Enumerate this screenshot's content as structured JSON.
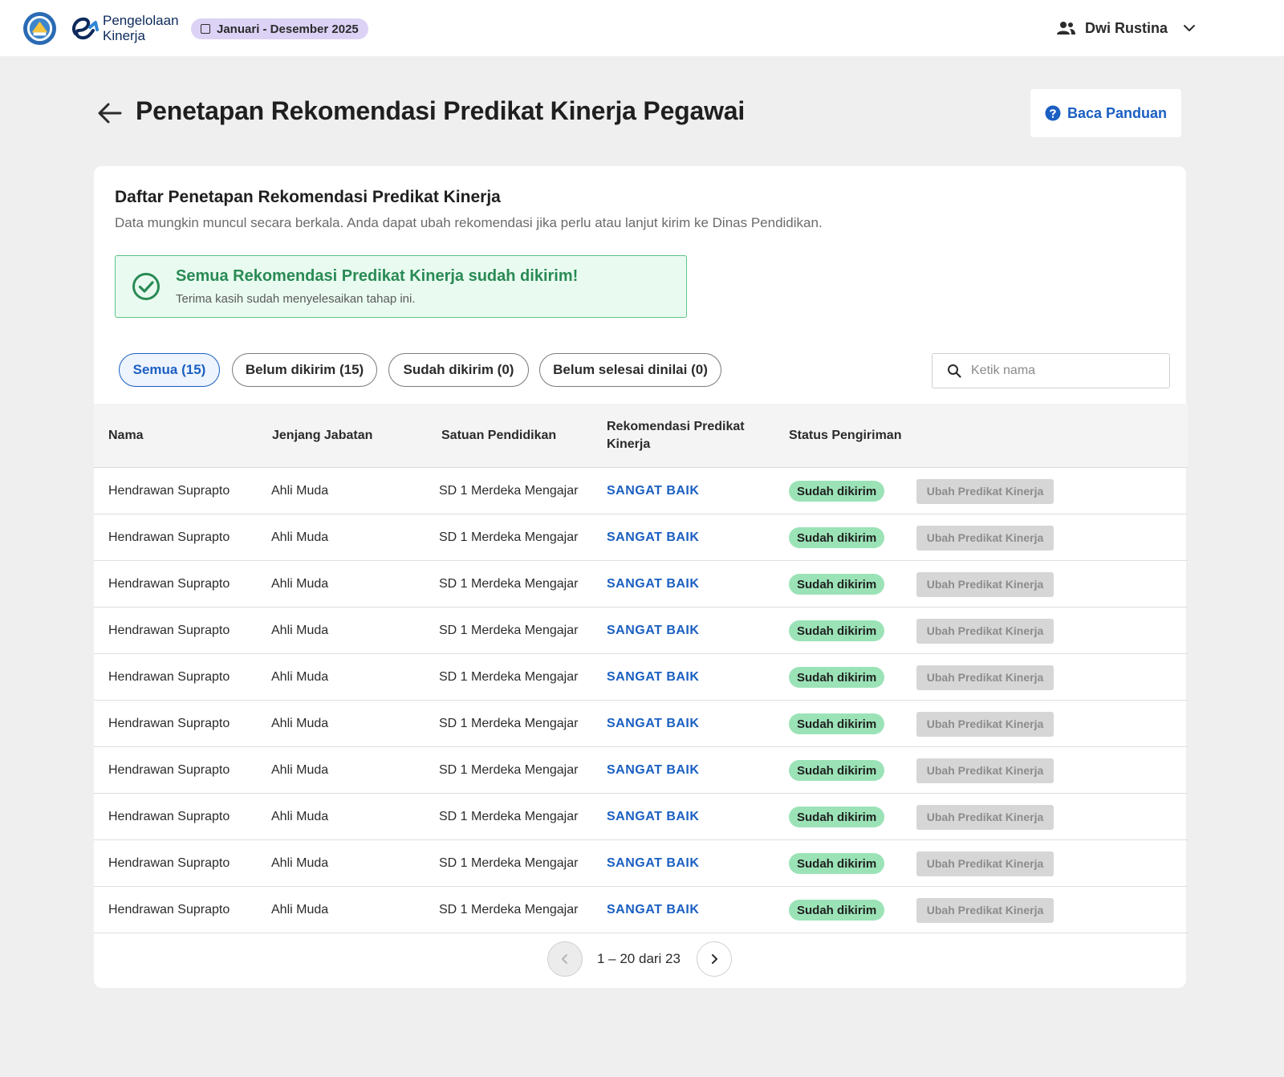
{
  "header": {
    "app_name_line1": "Pengelolaan",
    "app_name_line2": "Kinerja",
    "period": "Januari - Desember 2025",
    "user_name": "Dwi Rustina"
  },
  "page": {
    "title": "Penetapan Rekomendasi Predikat Kinerja Pegawai",
    "guide_label": "Baca Panduan"
  },
  "card": {
    "title": "Daftar Penetapan Rekomendasi Predikat Kinerja",
    "subtitle": "Data mungkin muncul secara berkala. Anda dapat ubah rekomendasi jika perlu atau lanjut kirim ke Dinas Pendidikan.",
    "alert": {
      "title": "Semua Rekomendasi Predikat Kinerja sudah dikirim!",
      "text": "Terima kasih sudah menyelesaikan tahap ini."
    }
  },
  "filters": [
    {
      "label": "Semua (15)",
      "active": true
    },
    {
      "label": "Belum dikirim (15)",
      "active": false
    },
    {
      "label": "Sudah dikirim (0)",
      "active": false
    },
    {
      "label": "Belum selesai dinilai (0)",
      "active": false
    }
  ],
  "search": {
    "placeholder": "Ketik nama"
  },
  "table": {
    "columns": [
      "Nama",
      "Jenjang Jabatan",
      "Satuan Pendidikan",
      "Rekomendasi Predikat Kinerja",
      "Status Pengiriman"
    ],
    "action_label": "Ubah Predikat Kinerja",
    "rows": [
      {
        "nama": "Hendrawan Suprapto",
        "jenjang": "Ahli Muda",
        "satuan": "SD 1 Merdeka Mengajar",
        "predikat": "SANGAT BAIK",
        "status": "Sudah dikirim"
      },
      {
        "nama": "Hendrawan Suprapto",
        "jenjang": "Ahli Muda",
        "satuan": "SD 1 Merdeka Mengajar",
        "predikat": "SANGAT BAIK",
        "status": "Sudah dikirim"
      },
      {
        "nama": "Hendrawan Suprapto",
        "jenjang": "Ahli Muda",
        "satuan": "SD 1 Merdeka Mengajar",
        "predikat": "SANGAT BAIK",
        "status": "Sudah dikirim"
      },
      {
        "nama": "Hendrawan Suprapto",
        "jenjang": "Ahli Muda",
        "satuan": "SD 1 Merdeka Mengajar",
        "predikat": "SANGAT BAIK",
        "status": "Sudah dikirim"
      },
      {
        "nama": "Hendrawan Suprapto",
        "jenjang": "Ahli Muda",
        "satuan": "SD 1 Merdeka Mengajar",
        "predikat": "SANGAT BAIK",
        "status": "Sudah dikirim"
      },
      {
        "nama": "Hendrawan Suprapto",
        "jenjang": "Ahli Muda",
        "satuan": "SD 1 Merdeka Mengajar",
        "predikat": "SANGAT BAIK",
        "status": "Sudah dikirim"
      },
      {
        "nama": "Hendrawan Suprapto",
        "jenjang": "Ahli Muda",
        "satuan": "SD 1 Merdeka Mengajar",
        "predikat": "SANGAT BAIK",
        "status": "Sudah dikirim"
      },
      {
        "nama": "Hendrawan Suprapto",
        "jenjang": "Ahli Muda",
        "satuan": "SD 1 Merdeka Mengajar",
        "predikat": "SANGAT BAIK",
        "status": "Sudah dikirim"
      },
      {
        "nama": "Hendrawan Suprapto",
        "jenjang": "Ahli Muda",
        "satuan": "SD 1 Merdeka Mengajar",
        "predikat": "SANGAT BAIK",
        "status": "Sudah dikirim"
      },
      {
        "nama": "Hendrawan Suprapto",
        "jenjang": "Ahli Muda",
        "satuan": "SD 1 Merdeka Mengajar",
        "predikat": "SANGAT BAIK",
        "status": "Sudah dikirim"
      }
    ]
  },
  "pagination": {
    "label": "1 – 20 dari 23"
  },
  "colors": {
    "accent": "#1a5fc2",
    "success_text": "#2a8a55",
    "success_bg": "#e9fbf0",
    "status_badge": "#9be3b7",
    "period_badge": "#dcd2f6"
  },
  "icons": [
    "gov-emblem-icon",
    "app-logo-icon",
    "calendar-icon",
    "users-icon",
    "chevron-down-icon",
    "arrow-left-icon",
    "help-circle-icon",
    "check-circle-icon",
    "search-icon",
    "chevron-left-icon",
    "chevron-right-icon"
  ]
}
